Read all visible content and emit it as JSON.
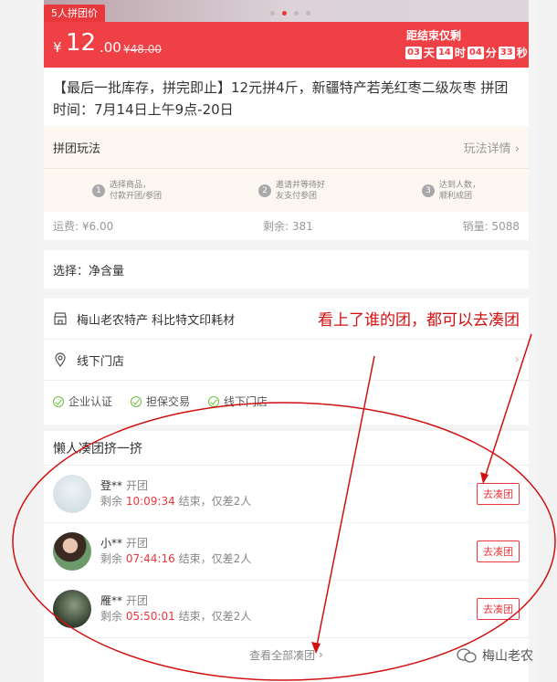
{
  "banner": {
    "group_tag": "5人拼团价",
    "currency": "¥",
    "price_int": "12",
    "price_dec": ".00",
    "old_price": "¥48.00",
    "countdown_label": "距结束仅剩",
    "cd_days": "03",
    "cd_day_unit": "天",
    "cd_hours": "14",
    "cd_hour_unit": "时",
    "cd_minutes": "04",
    "cd_minute_unit": "分",
    "cd_seconds": "33",
    "cd_second_unit": "秒"
  },
  "product": {
    "title": "【最后一批库存，拼完即止】12元拼4斤，新疆特产若羌红枣二级灰枣 拼团时间：7月14日上午9点-20日"
  },
  "rules": {
    "label": "拼团玩法",
    "more": "玩法详情",
    "steps": [
      {
        "num": "1",
        "line1": "选择商品，",
        "line2": "付款开团/参团"
      },
      {
        "num": "2",
        "line1": "邀请并等待好",
        "line2": "友支付参团"
      },
      {
        "num": "3",
        "line1": "达到人数，",
        "line2": "顺利成团"
      }
    ],
    "shipping": "运费: ¥6.00",
    "stock": "剩余: 381",
    "sales": "销量: 5088"
  },
  "select": {
    "label": "选择：净含量"
  },
  "store": {
    "name": "梅山老农特产 科比特文印耗材",
    "offline": "线下门店",
    "badges": [
      "企业认证",
      "担保交易",
      "线下门店"
    ]
  },
  "groups": {
    "title": "懒人凑团挤一挤",
    "items": [
      {
        "name": "登**",
        "open": "开团",
        "prefix": "剩余",
        "time": "10:09:34",
        "suffix": "结束，仅差2人",
        "button": "去凑团"
      },
      {
        "name": "小**",
        "open": "开团",
        "prefix": "剩余",
        "time": "07:44:16",
        "suffix": "结束，仅差2人",
        "button": "去凑团"
      },
      {
        "name": "雁**",
        "open": "开团",
        "prefix": "剩余",
        "time": "05:50:01",
        "suffix": "结束，仅差2人",
        "button": "去凑团"
      }
    ],
    "view_all": "查看全部凑团"
  },
  "annotation": {
    "text": "看上了谁的团，都可以去凑团"
  },
  "watermark": "梅山老农",
  "colors": {
    "brand_red": "#ef4145",
    "annotation_red": "#d01010",
    "check_green": "#6bbf3a"
  }
}
